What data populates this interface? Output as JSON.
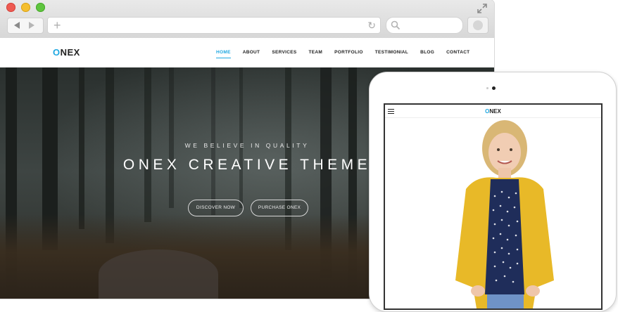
{
  "browser": {
    "icons": [
      "close-dot",
      "minimize-dot",
      "maximize-dot",
      "expand-icon",
      "back-arrow-icon",
      "forward-arrow-icon",
      "plus-icon",
      "reload-icon",
      "search-icon",
      "extension-icon"
    ],
    "url_plus": "+",
    "reload": "↻"
  },
  "site": {
    "logo_first": "O",
    "logo_rest": "NEX",
    "accent_color": "#1ea7e1",
    "menu": [
      {
        "label": "HOME",
        "active": true
      },
      {
        "label": "ABOUT"
      },
      {
        "label": "SERVICES"
      },
      {
        "label": "TEAM"
      },
      {
        "label": "PORTFOLIO"
      },
      {
        "label": "TESTIMONIAL"
      },
      {
        "label": "BLOG"
      },
      {
        "label": "CONTACT"
      }
    ]
  },
  "hero": {
    "tagline": "WE BELIEVE IN QUALITY",
    "title": "ONEX CREATIVE THEME",
    "discover_button": "DISCOVER NOW",
    "purchase_button": "PURCHASE ONEX"
  },
  "tablet": {
    "logo_first": "O",
    "logo_rest": "NEX"
  }
}
